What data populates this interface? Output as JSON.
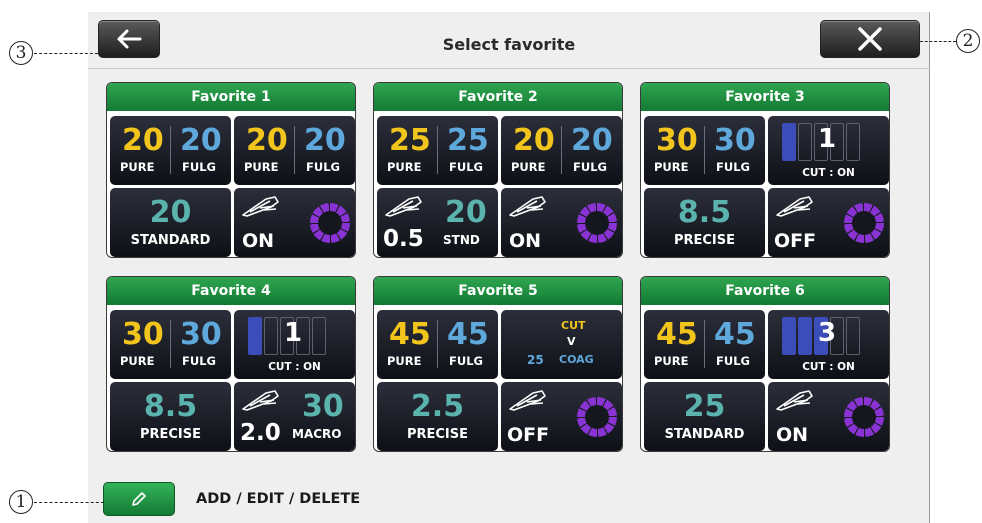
{
  "header": {
    "title": "Select favorite",
    "back_icon": "arrow-left-icon",
    "close_icon": "close-icon"
  },
  "colors": {
    "header_green": "#1f9140",
    "pure": "#f2c51d",
    "fulg": "#5ea8dc",
    "blend": "#5bb3ad",
    "ring": "#8a33d4",
    "bar_active": "#3a4db8"
  },
  "favorites": [
    {
      "title": "Favorite 1",
      "a": {
        "v1": "20",
        "l1": "PURE",
        "v2": "20",
        "l2": "FULG"
      },
      "b": {
        "v1": "20",
        "l1": "PURE",
        "v2": "20",
        "l2": "FULG"
      },
      "c": {
        "value": "20",
        "label": "STANDARD"
      },
      "d": {
        "state": "ON"
      }
    },
    {
      "title": "Favorite 2",
      "a": {
        "v1": "25",
        "l1": "PURE",
        "v2": "25",
        "l2": "FULG"
      },
      "b": {
        "v1": "20",
        "l1": "PURE",
        "v2": "20",
        "l2": "FULG"
      },
      "c": {
        "small": "0.5",
        "big": "20",
        "label": "STND"
      },
      "d": {
        "state": "ON"
      }
    },
    {
      "title": "Favorite 3",
      "a": {
        "v1": "30",
        "l1": "PURE",
        "v2": "30",
        "l2": "FULG"
      },
      "b": {
        "level": "1",
        "level_value": 1,
        "label": "CUT : ON"
      },
      "c": {
        "value": "8.5",
        "label": "PRECISE"
      },
      "d": {
        "state": "OFF"
      }
    },
    {
      "title": "Favorite 4",
      "a": {
        "v1": "30",
        "l1": "PURE",
        "v2": "30",
        "l2": "FULG"
      },
      "b": {
        "level": "1",
        "level_value": 1,
        "label": "CUT : ON"
      },
      "c": {
        "value": "8.5",
        "label": "PRECISE"
      },
      "d": {
        "small": "2.0",
        "big": "30",
        "label": "MACRO"
      }
    },
    {
      "title": "Favorite 5",
      "a": {
        "v1": "45",
        "l1": "PURE",
        "v2": "45",
        "l2": "FULG"
      },
      "b": {
        "cut": "CUT",
        "v": "V",
        "coag_value": "25",
        "coag": "COAG"
      },
      "c": {
        "value": "2.5",
        "label": "PRECISE"
      },
      "d": {
        "state": "OFF"
      }
    },
    {
      "title": "Favorite 6",
      "a": {
        "v1": "45",
        "l1": "PURE",
        "v2": "45",
        "l2": "FULG"
      },
      "b": {
        "level": "3",
        "level_value": 3,
        "label": "CUT : ON"
      },
      "c": {
        "value": "25",
        "label": "STANDARD"
      },
      "d": {
        "state": "ON"
      }
    }
  ],
  "footer": {
    "add_edit_delete_label": "ADD / EDIT / DELETE",
    "edit_icon": "pencil-icon"
  },
  "callouts": {
    "one": "1",
    "two": "2",
    "three": "3"
  }
}
